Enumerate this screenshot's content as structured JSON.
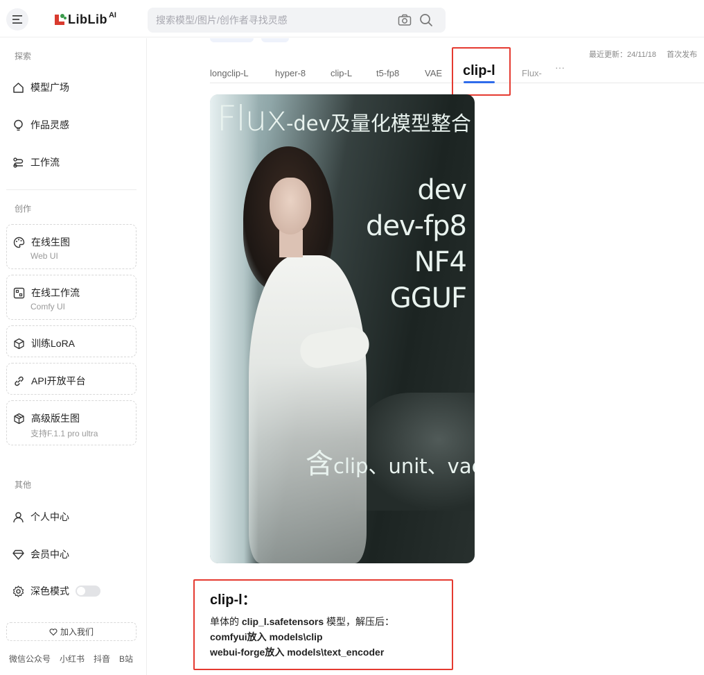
{
  "header": {
    "logo_text": "LibLib",
    "logo_sup": "AI",
    "search_placeholder": "搜索模型/图片/创作者寻找灵感"
  },
  "sidebar": {
    "section_explore": "探索",
    "explore_items": [
      {
        "label": "模型广场",
        "icon": "home-icon"
      },
      {
        "label": "作品灵感",
        "icon": "bulb-icon"
      },
      {
        "label": "工作流",
        "icon": "workflow-icon"
      }
    ],
    "section_create": "创作",
    "create_cards": [
      {
        "label": "在线生图",
        "sub": "Web UI",
        "icon": "palette-icon"
      },
      {
        "label": "在线工作流",
        "sub": "Comfy UI",
        "icon": "comfy-icon"
      },
      {
        "label": "训练LoRA",
        "sub": "",
        "icon": "cube-icon"
      },
      {
        "label": "API开放平台",
        "sub": "",
        "icon": "link-icon"
      },
      {
        "label": "高级版生图",
        "sub": "支持F.1.1 pro ultra",
        "icon": "box-icon"
      }
    ],
    "section_other": "其他",
    "other_items": [
      {
        "label": "个人中心",
        "icon": "user-icon"
      },
      {
        "label": "会员中心",
        "icon": "diamond-icon"
      },
      {
        "label": "深色模式",
        "icon": "gear-icon"
      }
    ],
    "join_label": "加入我们",
    "footer_links": [
      "微信公众号",
      "小红书",
      "抖音",
      "B站"
    ]
  },
  "main": {
    "tabs": [
      "longclip-L",
      "hyper-8",
      "clip-L",
      "t5-fp8",
      "VAE",
      "clip-l",
      "Flux-"
    ],
    "active_tab": "clip-l",
    "more": "···",
    "meta_updated": "最近更新：24/11/18",
    "meta_first": "首次发布"
  },
  "cover": {
    "title_big": "Flux",
    "title_rest": "-dev及量化模型整合",
    "variants": [
      "dev",
      "dev-fp8",
      "NF4",
      "GGUF"
    ],
    "bottom_big": "含",
    "bottom_rest": "clip、unit、vae"
  },
  "description": {
    "title": "clip-l：",
    "line1_pre": "单体的 ",
    "line1_bold": "clip_l.safetensors",
    "line1_post": " 模型，解压后：",
    "line2": "comfyui放入 models\\clip",
    "line3": "webui-forge放入 models\\text_encoder"
  }
}
